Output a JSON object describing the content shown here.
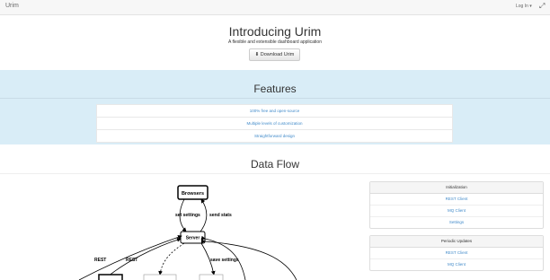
{
  "navbar": {
    "brand": "Urim",
    "login": "Log In ▾",
    "expand_icon": "expand-icon"
  },
  "hero": {
    "title": "Introducing Urim",
    "subtitle": "A flexible and extensible dashboard application",
    "download_label": "Download Urim",
    "download_icon": "download-icon"
  },
  "features": {
    "title": "Features",
    "items": [
      "100% free and open-source",
      "Multiple levels of customization",
      "Straightforward design"
    ]
  },
  "dataflow": {
    "title": "Data Flow",
    "diagram": {
      "browsers": "Browsers",
      "server": "Server",
      "send_settings": "set settings",
      "send_stats": "send stats",
      "save_settings": "save settings",
      "rest1": "REST",
      "rest2": "REST"
    }
  },
  "panels": [
    {
      "title": "Initialization",
      "items": [
        "REST Client",
        "MQ Client",
        "Settings"
      ]
    },
    {
      "title": "Periodic Updates",
      "items": [
        "REST Client",
        "MQ Client"
      ]
    }
  ]
}
